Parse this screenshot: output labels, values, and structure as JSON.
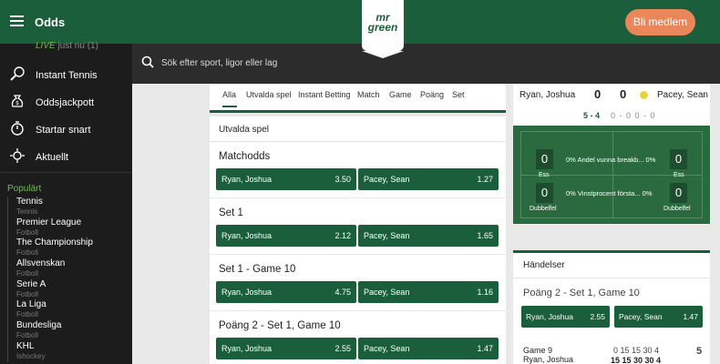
{
  "header": {
    "title": "Odds",
    "logo": "mr green",
    "join_label": "Bli medlem"
  },
  "sidebar": {
    "live": {
      "label": "LIVE",
      "suffix": "just nu",
      "count": "(1)"
    },
    "items": [
      {
        "label": "Instant Tennis",
        "icon": "tennis-racket-icon"
      },
      {
        "label": "Oddsjackpott",
        "icon": "money-bag-icon"
      },
      {
        "label": "Startar snart",
        "icon": "stopwatch-icon"
      },
      {
        "label": "Aktuellt",
        "icon": "star-burst-icon"
      }
    ],
    "popular_heading": "Populärt",
    "popular": [
      {
        "name": "Tennis",
        "sport": "Tennis"
      },
      {
        "name": "Premier League",
        "sport": "Fotboll"
      },
      {
        "name": "The Championship",
        "sport": "Fotboll"
      },
      {
        "name": "Allsvenskan",
        "sport": "Fotboll"
      },
      {
        "name": "Serie A",
        "sport": "Fotboll"
      },
      {
        "name": "La Liga",
        "sport": "Fotboll"
      },
      {
        "name": "Bundesliga",
        "sport": "Fotboll"
      },
      {
        "name": "KHL",
        "sport": "Ishockey"
      }
    ]
  },
  "search": {
    "placeholder": "Sök efter sport, ligor eller lag"
  },
  "tabs": [
    "Alla",
    "Utvalda spel",
    "Instant Betting",
    "Match",
    "Game",
    "Poäng",
    "Set"
  ],
  "main": {
    "section_title": "Utvalda spel",
    "markets": [
      {
        "title": "Matchodds",
        "p1": "Ryan, Joshua",
        "o1": "3.50",
        "p2": "Pacey, Sean",
        "o2": "1.27"
      },
      {
        "title": "Set 1",
        "p1": "Ryan, Joshua",
        "o1": "2.12",
        "p2": "Pacey, Sean",
        "o2": "1.65"
      },
      {
        "title": "Set 1 - Game 10",
        "p1": "Ryan, Joshua",
        "o1": "4.75",
        "p2": "Pacey, Sean",
        "o2": "1.16"
      },
      {
        "title": "Poäng 2 - Set 1, Game 10",
        "p1": "Ryan, Joshua",
        "o1": "2.55",
        "p2": "Pacey, Sean",
        "o2": "1.47"
      }
    ]
  },
  "scoreboard": {
    "player1": "Ryan, Joshua",
    "score1": "0",
    "player2": "Pacey, Sean",
    "score2": "0",
    "games": "5 - 4",
    "rest": "0 - 0   0 - 0"
  },
  "court": {
    "aces1": "0",
    "aces2": "0",
    "ace_label": "Ess",
    "df1": "0",
    "df2": "0",
    "df_label": "Dubbelfel",
    "row1_text": "0%  Andel vunna breakb...  0%",
    "row2_text": "0%  Vinstprocent första...  0%"
  },
  "events": {
    "heading": "Händelser",
    "market_title": "Poäng 2 - Set 1, Game 10",
    "p1": "Ryan, Joshua",
    "o1": "2.55",
    "p2": "Pacey, Sean",
    "o2": "1.47",
    "game_label": "Game 9",
    "game_player": "Ryan, Joshua",
    "points_top": "0   15   15   30   4",
    "points_bottom": "15   15   30   30   4",
    "game_right": "5"
  }
}
